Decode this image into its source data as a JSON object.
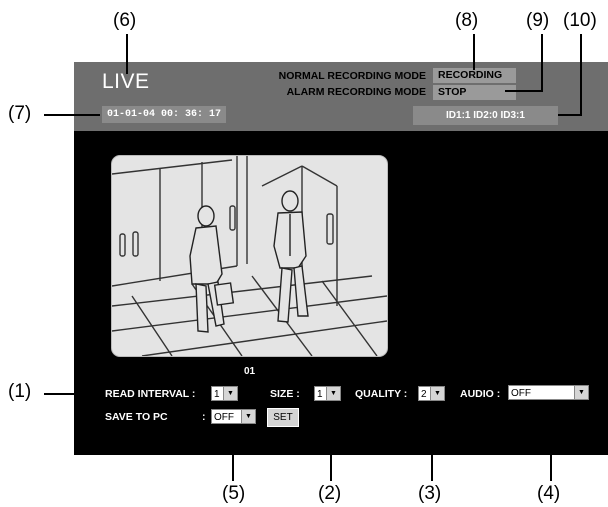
{
  "callouts": {
    "c1": "(1)",
    "c2": "(2)",
    "c3": "(3)",
    "c4": "(4)",
    "c5": "(5)",
    "c6": "(6)",
    "c7": "(7)",
    "c8": "(8)",
    "c9": "(9)",
    "c10": "(10)"
  },
  "header": {
    "title": "LIVE",
    "datetime": "01-01-04  00: 36: 17",
    "normal_mode_label": "NORMAL RECORDING MODE",
    "normal_mode_value": "RECORDING",
    "alarm_mode_label": "ALARM RECORDING MODE",
    "alarm_mode_value": "STOP",
    "id_status": "ID1:1  ID2:0  ID3:1"
  },
  "camera": {
    "label": "01"
  },
  "controls": {
    "read_interval_label": "READ INTERVAL :",
    "read_interval_value": "1",
    "size_label": "SIZE   :",
    "size_value": "1",
    "quality_label": "QUALITY :",
    "quality_value": "2",
    "audio_label": "AUDIO :",
    "audio_value": "OFF",
    "save_label": "SAVE TO PC",
    "save_colon": ":",
    "save_value": "OFF",
    "set_label": "SET"
  },
  "colors": {
    "panel": "#000000",
    "header": "#6e6e6e"
  }
}
